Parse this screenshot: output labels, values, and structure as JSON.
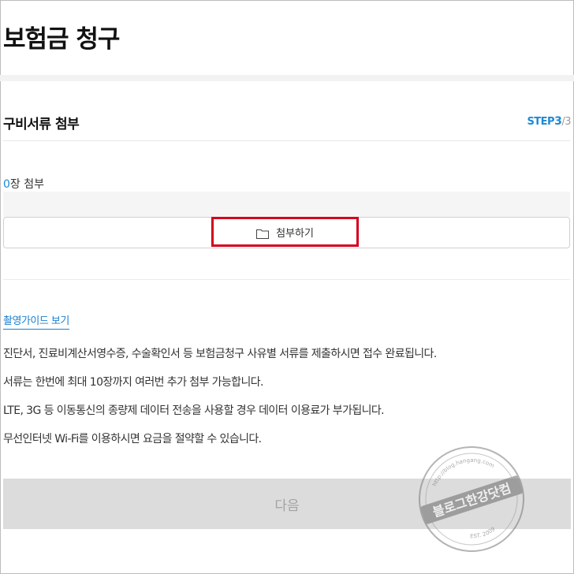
{
  "header": {
    "title": "보험금 청구"
  },
  "section": {
    "title": "구비서류 첨부",
    "step_prefix": "STEP",
    "step_current": "3",
    "step_separator": "/",
    "step_total": "3"
  },
  "attach": {
    "count_value": "0",
    "count_suffix": "장 첨부",
    "button_label": "첨부하기",
    "icon": "folder-icon"
  },
  "guide": {
    "link_label": "촬영가이드 보기"
  },
  "notices": [
    "진단서, 진료비계산서영수증, 수술확인서 등 보험금청구 사유별 서류를 제출하시면 접수 완료됩니다.",
    "서류는 한번에 최대 10장까지 여러번 추가 첨부 가능합니다.",
    "LTE, 3G 등 이동통신의 종량제 데이터 전송을 사용할 경우 데이터 이용료가 부가됩니다.",
    "무선인터넷 Wi-Fi를 이용하시면 요금을 절약할 수 있습니다."
  ],
  "footer": {
    "next_label": "다음"
  },
  "watermark": {
    "main_text": "블로그한강닷컴",
    "top_text": "http://blog.hangang.com",
    "bottom_text": "EST. 2009"
  },
  "colors": {
    "accent": "#1a8ad6",
    "highlight_border": "#d3001e",
    "disabled_button_bg": "#dcdcdc",
    "disabled_button_text": "#a3a3a3"
  }
}
